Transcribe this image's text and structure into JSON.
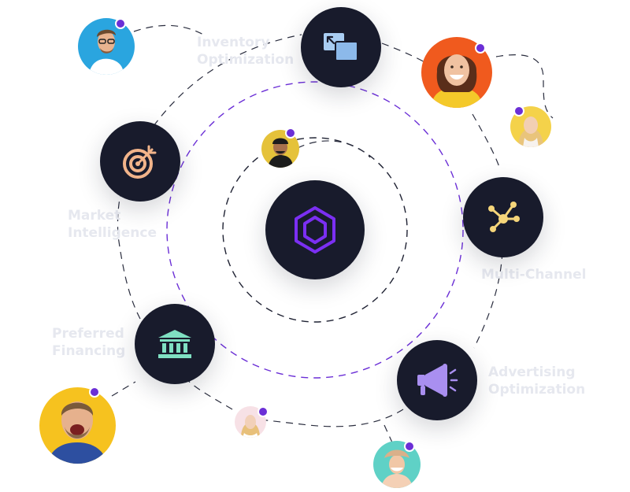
{
  "features": [
    {
      "label": "Inventory\nOptimization",
      "icon": "resize-windows-icon"
    },
    {
      "label": "Market\nIntelligence",
      "icon": "target-arrow-icon"
    },
    {
      "label": "Multi-Channel",
      "icon": "network-nodes-icon"
    },
    {
      "label": "Preferred\nFinancing",
      "icon": "bank-icon"
    },
    {
      "label": "Advertising\nOptimization",
      "icon": "megaphone-icon"
    }
  ],
  "center": {
    "icon": "hexagon-logo-icon"
  },
  "colors": {
    "node_bg": "#181b2c",
    "inner_orbit": "#1f2233",
    "middle_orbit": "#6b2fd6",
    "accent_dot": "#6b2fd6",
    "label": "#e6e8ef",
    "logo": "#7b2ff2",
    "inventory_icon": "#a9cdf2",
    "market_icon": "#f2b48a",
    "multichannel_icon": "#f5d57a",
    "financing_icon": "#7fe0c2",
    "advertising_icon": "#a98ff0"
  },
  "avatars": [
    "avatar-man-glasses",
    "avatar-woman-yellow-sweater",
    "avatar-woman-blonde-small",
    "avatar-man-cap",
    "avatar-man-laughing",
    "avatar-woman-small-bottom",
    "avatar-woman-hat"
  ]
}
